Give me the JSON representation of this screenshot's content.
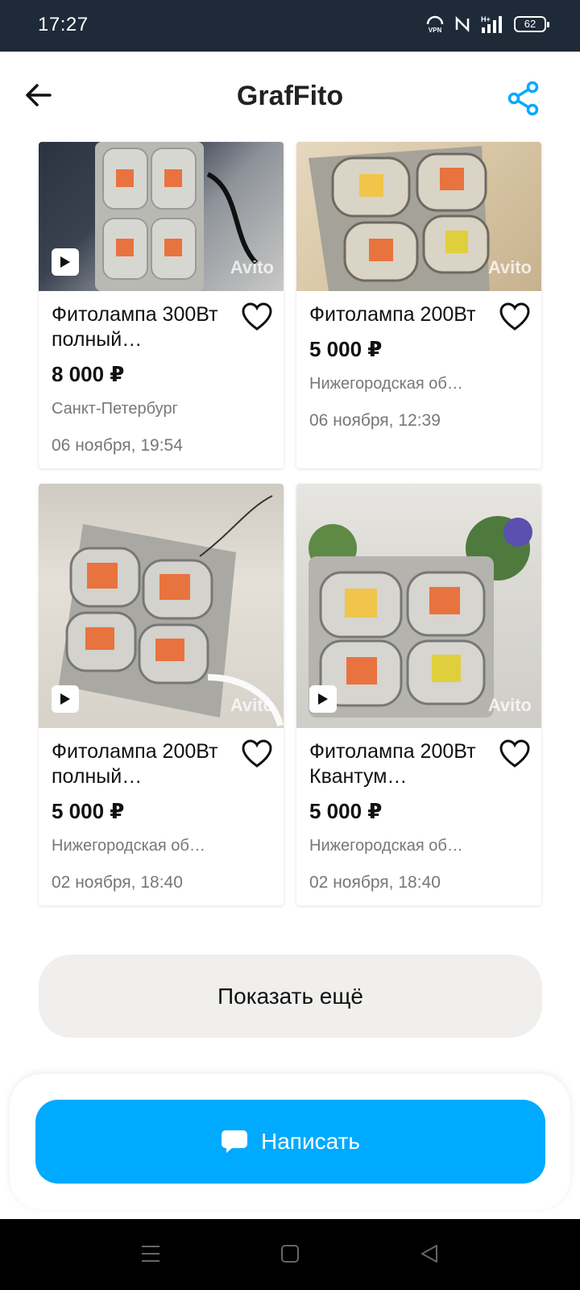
{
  "status_bar": {
    "time": "17:27",
    "battery": "62",
    "icons": [
      "vpn-icon",
      "nfc-icon",
      "signal-icon",
      "battery-icon"
    ]
  },
  "header": {
    "title": "GrafFito",
    "back_icon": "arrow-left-icon",
    "share_icon": "share-icon"
  },
  "listings": [
    {
      "title": "Фитолампа 300Вт полный…",
      "price": "8 000 ₽",
      "location": "Санкт-Петербург",
      "date": "06 ноября, 19:54",
      "has_video": true,
      "watermark": "Avito"
    },
    {
      "title": "Фитолампа 200Вт",
      "price": "5 000 ₽",
      "location": "Нижегородская об…",
      "date": "06 ноября, 12:39",
      "has_video": false,
      "watermark": "Avito"
    },
    {
      "title": "Фитолампа 200Вт полный…",
      "price": "5 000 ₽",
      "location": "Нижегородская об…",
      "date": "02 ноября, 18:40",
      "has_video": true,
      "watermark": "Avito"
    },
    {
      "title": "Фитолампа 200Вт Квантум…",
      "price": "5 000 ₽",
      "location": "Нижегородская об…",
      "date": "02 ноября, 18:40",
      "has_video": true,
      "watermark": "Avito"
    }
  ],
  "show_more": {
    "label": "Показать ещё"
  },
  "write_button": {
    "label": "Написать",
    "icon": "chat-bubble-icon"
  },
  "nav": {
    "icons": [
      "menu-icon",
      "home-icon",
      "back-triangle-icon"
    ]
  },
  "colors": {
    "accent": "#00aaff",
    "status_bar": "#1e2a38",
    "muted_text": "#777777",
    "button_bg": "#f0efed"
  }
}
